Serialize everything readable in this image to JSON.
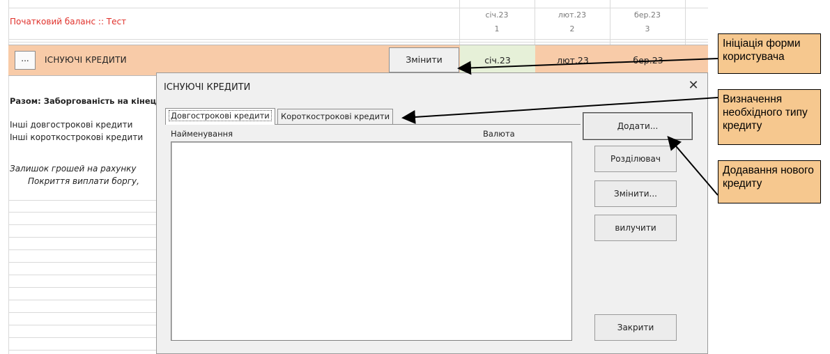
{
  "sheet": {
    "title": "Початковий баланс :: Тест",
    "header_months": [
      {
        "label": "січ.23",
        "num": "1"
      },
      {
        "label": "лют.23",
        "num": "2"
      },
      {
        "label": "бер.23",
        "num": "3"
      }
    ],
    "section": {
      "more_button": "...",
      "heading": "ІСНУЮЧІ КРЕДИТИ",
      "change_button": "Змінити",
      "months": [
        "січ.23",
        "лют.23",
        "бер.23"
      ]
    },
    "rows": [
      {
        "label": "Разом: Заборгованість на кінец",
        "style": "bold"
      },
      {
        "label": "Інші довгострокові кредити",
        "style": "normal"
      },
      {
        "label": "Інші короткострокові кредити",
        "style": "normal"
      },
      {
        "label": "Залишок грошей на рахунку",
        "style": "italic"
      },
      {
        "label": "Покриття виплати боргу,",
        "style": "italic"
      }
    ]
  },
  "dialog": {
    "title": "ІСНУЮЧІ КРЕДИТИ",
    "close_glyph": "✕",
    "tabs": [
      "Довгострокові кредити",
      "Короткострокові кредити"
    ],
    "selected_tab": 0,
    "columns": [
      "Найменування",
      "Валюта"
    ],
    "buttons": {
      "add": "Додати...",
      "separator": "Розділювач",
      "edit": "Змінити...",
      "delete": "вилучити",
      "close": "Закрити"
    }
  },
  "callouts": [
    "Ініціація форми користувача",
    "Визначення необхідного типу кредиту",
    "Додавання нового кредиту"
  ],
  "colors": {
    "title_red": "#e0312b",
    "orange_row": "#f8cba8",
    "active_month": "#e6f0d8",
    "callout": "#f6c88f"
  }
}
